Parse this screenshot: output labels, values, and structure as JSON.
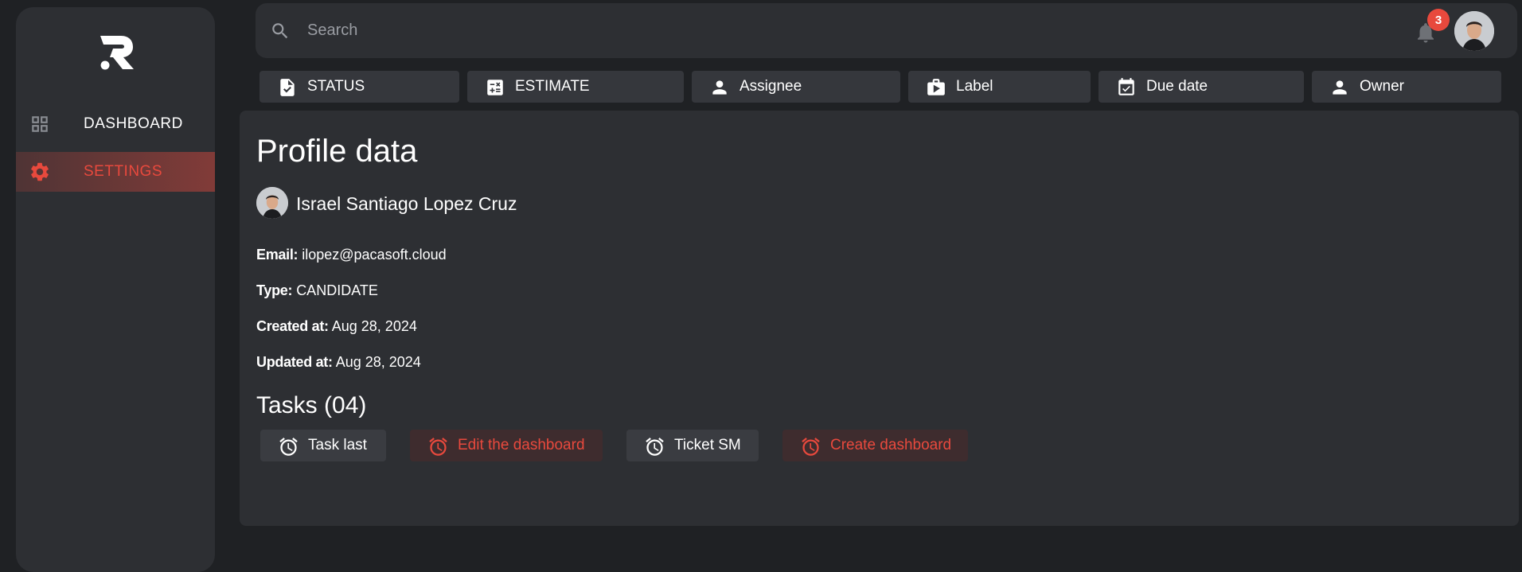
{
  "sidebar": {
    "logo_icon": "r-brand-logo",
    "items": [
      {
        "label": "DASHBOARD",
        "icon": "grid-icon"
      },
      {
        "label": "SETTINGS",
        "icon": "gear-icon"
      }
    ]
  },
  "topbar": {
    "search_placeholder": "Search",
    "notification_count": "3"
  },
  "filters": [
    {
      "label": "STATUS",
      "icon": "file-check-icon"
    },
    {
      "label": "ESTIMATE",
      "icon": "calculator-icon"
    },
    {
      "label": "Assignee",
      "icon": "person-icon"
    },
    {
      "label": "Label",
      "icon": "play-bag-icon"
    },
    {
      "label": "Due date",
      "icon": "calendar-check-icon"
    },
    {
      "label": "Owner",
      "icon": "person-icon"
    }
  ],
  "profile": {
    "title": "Profile data",
    "name": "Israel Santiago Lopez Cruz",
    "email_label": "Email:",
    "email": "ilopez@pacasoft.cloud",
    "type_label": "Type:",
    "type": "CANDIDATE",
    "created_label": "Created at:",
    "created": "Aug 28, 2024",
    "updated_label": "Updated at:",
    "updated": "Aug 28, 2024"
  },
  "tasks": {
    "title": "Tasks (04)",
    "items": [
      {
        "label": "Task last",
        "state": "normal"
      },
      {
        "label": "Edit the dashboard",
        "state": "overdue"
      },
      {
        "label": "Ticket SM",
        "state": "normal"
      },
      {
        "label": "Create dashboard",
        "state": "overdue"
      }
    ]
  },
  "colors": {
    "accent": "#e8493d",
    "background": "#1f2124",
    "surface": "#2d2f33"
  }
}
